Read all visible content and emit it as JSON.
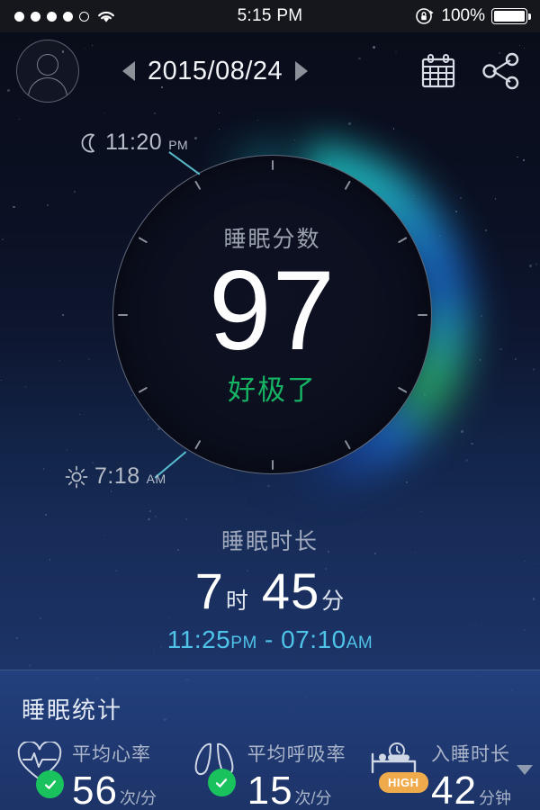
{
  "statusbar": {
    "signal_dots": 5,
    "signal_filled": 4,
    "wifi_icon": "wifi-icon",
    "time": "5:15 PM",
    "rotation_lock_icon": "rotation-lock-icon",
    "battery_percent": "100%",
    "battery_icon": "battery-full-icon"
  },
  "header": {
    "avatar_icon": "user-avatar-icon",
    "prev_icon": "chevron-left-icon",
    "date": "2015/08/24",
    "next_icon": "chevron-right-icon",
    "calendar_icon": "calendar-icon",
    "share_icon": "share-icon"
  },
  "dial": {
    "bedtime": {
      "icon": "moon-icon",
      "time": "11:20",
      "ampm": "PM"
    },
    "waketime": {
      "icon": "sun-icon",
      "time": "7:18",
      "ampm": "AM"
    },
    "score_label": "睡眠分数",
    "score_value": "97",
    "score_rating": "好极了",
    "rating_color": "#17b364",
    "tick_count": 12
  },
  "duration": {
    "label": "睡眠时长",
    "hours": "7",
    "hours_unit": "时",
    "minutes": "45",
    "minutes_unit": "分",
    "range_start": "11:25",
    "range_start_ampm": "PM",
    "range_separator": " - ",
    "range_end": "07:10",
    "range_end_ampm": "AM",
    "range_color": "#4fc3e8"
  },
  "stats": {
    "title": "睡眠统计",
    "items": [
      {
        "icon": "heart-rate-icon",
        "status_icon": "check-circle-icon",
        "status_color": "#19c25c",
        "name": "平均心率",
        "value": "56",
        "unit": "次/分"
      },
      {
        "icon": "lungs-icon",
        "status_icon": "check-circle-icon",
        "status_color": "#19c25c",
        "name": "平均呼吸率",
        "value": "15",
        "unit": "次/分"
      },
      {
        "icon": "bed-clock-icon",
        "badge": "HIGH",
        "badge_color": "#efab4b",
        "name": "入睡时长",
        "value": "42",
        "unit": "分钟",
        "trend_icon": "caret-down-icon"
      }
    ]
  }
}
